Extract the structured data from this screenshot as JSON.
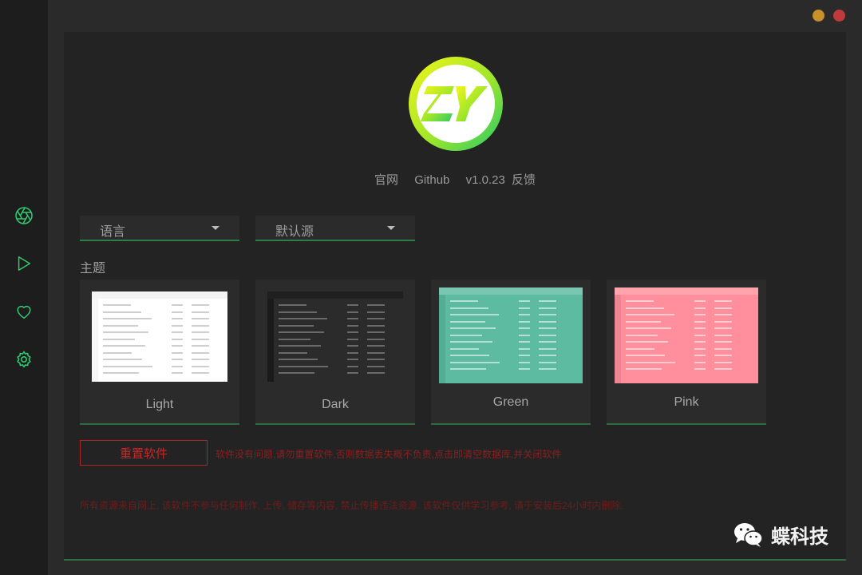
{
  "sidebar": {
    "items": [
      {
        "icon": "aperture-icon"
      },
      {
        "icon": "play-icon"
      },
      {
        "icon": "heart-icon"
      },
      {
        "icon": "gear-icon"
      }
    ],
    "accent": "#2ecc71"
  },
  "window": {
    "minimize_color": "#c8902a",
    "close_color": "#c0393c"
  },
  "about": {
    "links": [
      "官网",
      "Github",
      "v1.0.23",
      "反馈"
    ]
  },
  "settings": {
    "language_select": "语言",
    "source_select": "默认源",
    "theme_heading": "主题",
    "themes": [
      {
        "name": "Light",
        "color": "#ffffff"
      },
      {
        "name": "Dark",
        "color": "#2b2b2b"
      },
      {
        "name": "Green",
        "color": "#5cbba0"
      },
      {
        "name": "Pink",
        "color": "#ff8f9c"
      }
    ],
    "reset_button": "重置软件",
    "reset_desc": "软件没有问题,请勿重置软件,否则数据丢失概不负责,点击即清空数据库,并关闭软件",
    "disclaimer": "所有资源来自网上, 该软件不参与任何制作, 上传, 储存等内容, 禁止传播违法资源. 该软件仅供学习参考, 请于安装后24小时内删除."
  },
  "watermark": {
    "text": "蝶科技"
  }
}
